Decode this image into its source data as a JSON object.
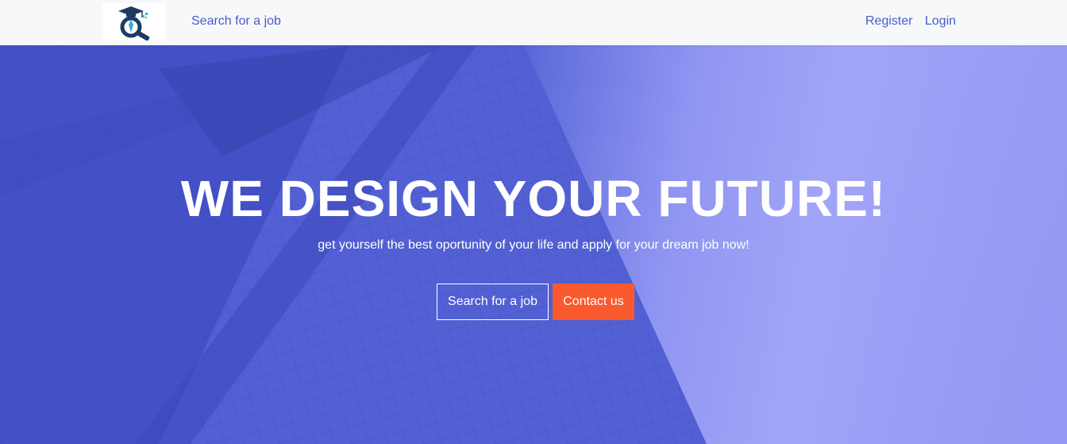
{
  "nav": {
    "logo_icon": "graduate-magnifier-logo",
    "search_link": "Search for a job",
    "register_link": "Register",
    "login_link": "Login"
  },
  "hero": {
    "headline": "WE DESIGN YOUR FUTURE!",
    "subtitle": "get yourself the best oportunity of your life and apply for your dream job now!",
    "search_button": "Search for a job",
    "contact_button": "Contact us"
  },
  "colors": {
    "nav_link": "#4a5cc9",
    "hero_blue": "#5564d6",
    "contact_button": "#fa5a2e"
  }
}
